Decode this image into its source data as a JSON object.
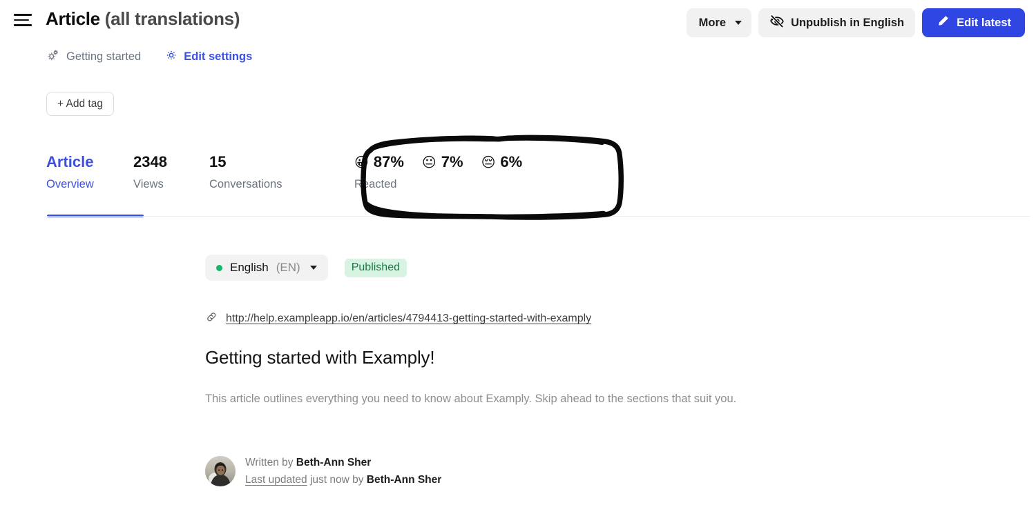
{
  "header": {
    "menu_icon": "hamburger-icon",
    "title_main": "Article",
    "title_sub": "(all translations)",
    "breadcrumb": [
      {
        "label": "Getting started",
        "icon": "gears-icon",
        "is_link": false
      },
      {
        "label": "Edit settings",
        "icon": "gear-icon",
        "is_link": true
      }
    ]
  },
  "actions": {
    "more_label": "More",
    "more_icon": "chevron-down-icon",
    "unpublish_label": "Unpublish in English",
    "unpublish_icon": "eye-slash-icon",
    "edit_label": "Edit latest",
    "edit_icon": "pencil-icon",
    "primary_color": "#3046e3"
  },
  "tags": {
    "add_tag_label": "+ Add tag"
  },
  "stats": [
    {
      "value": "Article",
      "label": "Overview",
      "active": true
    },
    {
      "value": "2348",
      "label": "Views",
      "active": false
    },
    {
      "value": "15",
      "label": "Conversations",
      "active": false
    }
  ],
  "reactions": {
    "label": "Reacted",
    "items": [
      {
        "emoji": "😀",
        "icon": "grinning-face-emoji",
        "percent": "87%"
      },
      {
        "emoji": "😐",
        "icon": "neutral-face-emoji",
        "percent": "7%"
      },
      {
        "emoji": "😔",
        "icon": "sad-face-emoji",
        "percent": "6%"
      }
    ]
  },
  "annotation": {
    "shape": "hand-drawn-rectangle",
    "color": "#000000"
  },
  "article": {
    "language_name": "English",
    "language_code": "(EN)",
    "language_status_color": "#12b76a",
    "status_badge": "Published",
    "status_badge_bg": "#d7f3e1",
    "status_badge_color": "#1d7a4b",
    "url": "http://help.exampleapp.io/en/articles/4794413-getting-started-with-examply",
    "url_icon": "link-icon",
    "title": "Getting started with Examply!",
    "description": "This article outlines everything you need to know about Examply. Skip ahead to the sections that suit you.",
    "byline": {
      "avatar_icon": "user-avatar",
      "written_prefix": "Written by ",
      "written_author": "Beth-Ann Sher",
      "updated_link": "Last updated",
      "updated_middle": " just now by ",
      "updated_author": "Beth-Ann Sher"
    }
  }
}
